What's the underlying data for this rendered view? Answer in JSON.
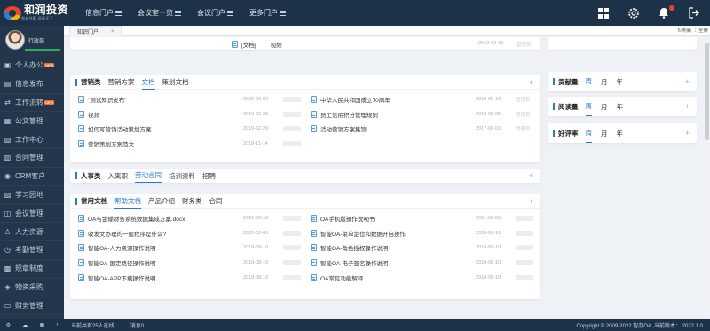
{
  "brand": {
    "name": "和润投资",
    "tagline": "和诚共赢 润泽天下"
  },
  "nav": [
    "信息门户",
    "会议室一览",
    "会议门户",
    "更多门户"
  ],
  "user": {
    "role": "行政部"
  },
  "sidebar": [
    {
      "label": "个人办公",
      "hot": "NEW"
    },
    {
      "label": "信息发布",
      "hot": ""
    },
    {
      "label": "工作流转",
      "hot": "NEW"
    },
    {
      "label": "公文管理",
      "hot": ""
    },
    {
      "label": "工作中心",
      "hot": ""
    },
    {
      "label": "合同管理",
      "hot": ""
    },
    {
      "label": "CRM客户",
      "hot": ""
    },
    {
      "label": "学习园地",
      "hot": ""
    },
    {
      "label": "会议管理",
      "hot": ""
    },
    {
      "label": "人力资源",
      "hot": ""
    },
    {
      "label": "考勤管理",
      "hot": ""
    },
    {
      "label": "规章制度",
      "hot": ""
    },
    {
      "label": "物资采购",
      "hot": ""
    },
    {
      "label": "财务管理",
      "hot": ""
    }
  ],
  "tabs": {
    "current": "知识门户",
    "refresh": "刷新",
    "fullscreen": "全屏"
  },
  "top_panel": {
    "title": "[文档]",
    "name": "视频",
    "date": "2019-02-25",
    "author": "管理员"
  },
  "marketing": {
    "tabs": [
      "营销类",
      "营销方案",
      "文档",
      "策划文档"
    ],
    "left": [
      {
        "title": "\"测试知识发布\"",
        "date": "2020-03-02"
      },
      {
        "title": "视频",
        "date": "2019-02-25"
      },
      {
        "title": "如何写营销活动策划方案",
        "date": "2019-02-20"
      },
      {
        "title": "营销策划方案范文",
        "date": "2018-11-14"
      }
    ],
    "right": [
      {
        "title": "中华人民共和国成立70周年",
        "date": "2019-09-10"
      },
      {
        "title": "员工信用积分管理规则",
        "date": "2018-08-05"
      },
      {
        "title": "活动营销方案集锦",
        "date": "2017-08-03"
      }
    ],
    "author": "管理员"
  },
  "hr": {
    "tabs": [
      "人事类",
      "入离职",
      "劳动合同",
      "培训资料",
      "招聘"
    ]
  },
  "common": {
    "tabs": [
      "常用文档",
      "帮助文档",
      "产品介绍",
      "财务类",
      "合同"
    ],
    "left": [
      {
        "title": "OA与金蝶财务系统数据集成方案.docx",
        "date": "2021-06-18"
      },
      {
        "title": "收发文办理的一般程序是什么?",
        "date": "2020-02-05"
      },
      {
        "title": "智能OA-人力资源操作说明",
        "date": "2018-08-10"
      },
      {
        "title": "智能OA-固定路径操作说明",
        "date": "2018-08-10"
      },
      {
        "title": "智能OA-APP下载操作说明",
        "date": "2018-08-10"
      }
    ],
    "right": [
      {
        "title": "OA手机版操作说明书",
        "date": "2021-02-05"
      },
      {
        "title": "智能OA-菜单定位和数据开启操作",
        "date": "2018-08-10"
      },
      {
        "title": "智能OA-角色授权操作说明",
        "date": "2018-08-10"
      },
      {
        "title": "智能OA-电子签名操作说明",
        "date": "2018-08-10"
      },
      {
        "title": "OA常见功能解释",
        "date": "2018-08-10"
      }
    ]
  },
  "rank_panels": [
    {
      "title": "贡献量",
      "tabs": [
        "周",
        "月",
        "年"
      ]
    },
    {
      "title": "阅读量",
      "tabs": [
        "周",
        "月",
        "年"
      ]
    },
    {
      "title": "好评率",
      "tabs": [
        "周",
        "月",
        "年"
      ]
    }
  ],
  "footer": {
    "online": "当前共有25人在线",
    "messages": "消息0",
    "copyright": "Copyright © 2009-2022 智办OA ,当前版本： 2022.1.0"
  },
  "colors": {
    "topbar": "#1d3148",
    "sidebar": "#23364c",
    "accent": "#2a78d6"
  }
}
